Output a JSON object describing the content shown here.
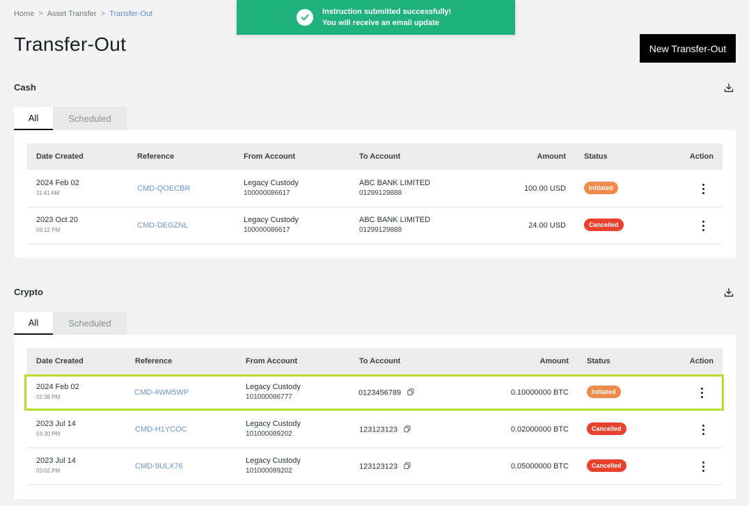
{
  "breadcrumb": {
    "home": "Home",
    "asset_transfer": "Asset Transfer",
    "current": "Transfer-Out",
    "sep": ">"
  },
  "page_title": "Transfer-Out",
  "toast": {
    "line1": "Instruction submitted successfully!",
    "line2": "You will receive an email update",
    "color": "#1fb27c"
  },
  "new_button": "New Transfer-Out",
  "cash": {
    "title": "Cash",
    "tabs": {
      "all": "All",
      "scheduled": "Scheduled"
    },
    "headers": {
      "date": "Date Created",
      "reference": "Reference",
      "from": "From Account",
      "to": "To Account",
      "amount": "Amount",
      "status": "Status",
      "action": "Action"
    },
    "rows": [
      {
        "date": "2024 Feb 02",
        "time": "11:41 AM",
        "reference": "CMD-QOECBR",
        "from_name": "Legacy Custody",
        "from_no": "100000086617",
        "to_name": "ABC BANK LIMITED",
        "to_no": "01299129888",
        "amount": "100.00 USD",
        "status": "Initiated"
      },
      {
        "date": "2023 Oct 20",
        "time": "09:12 PM",
        "reference": "CMD-DEGZNL",
        "from_name": "Legacy Custody",
        "from_no": "100000086617",
        "to_name": "ABC BANK LIMITED",
        "to_no": "01299129888",
        "amount": "24.00 USD",
        "status": "Cancelled"
      }
    ]
  },
  "crypto": {
    "title": "Crypto",
    "tabs": {
      "all": "All",
      "scheduled": "Scheduled"
    },
    "headers": {
      "date": "Date Created",
      "reference": "Reference",
      "from": "From Account",
      "to": "To Account",
      "amount": "Amount",
      "status": "Status",
      "action": "Action"
    },
    "rows": [
      {
        "date": "2024 Feb 02",
        "time": "02:38 PM",
        "reference": "CMD-4WM5WP",
        "from_name": "Legacy Custody",
        "from_no": "101000086777",
        "to": "0123456789",
        "amount": "0.10000000 BTC",
        "status": "Initiated"
      },
      {
        "date": "2023 Jul 14",
        "time": "03:30 PM",
        "reference": "CMD-H1YCOC",
        "from_name": "Legacy Custody",
        "from_no": "101000089202",
        "to": "123123123",
        "amount": "0.02000000 BTC",
        "status": "Cancelled"
      },
      {
        "date": "2023 Jul 14",
        "time": "03:02 PM",
        "reference": "CMD-9ULX76",
        "from_name": "Legacy Custody",
        "from_no": "101000089202",
        "to": "123123123",
        "amount": "0.05000000 BTC",
        "status": "Cancelled"
      }
    ]
  },
  "icons": {
    "download": "download-icon",
    "copy": "copy-icon",
    "check": "check-icon",
    "more": "more-vertical-icon"
  },
  "colors": {
    "highlight": "#b6dd2a",
    "initiated": "#f08a4b",
    "cancelled": "#e8412e",
    "link": "#6a95cf"
  }
}
